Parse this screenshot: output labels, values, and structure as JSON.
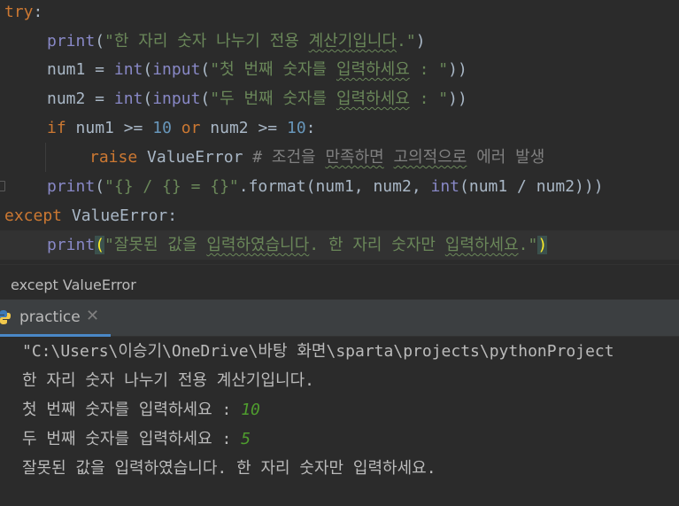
{
  "editor": {
    "l1": {
      "kw": "try",
      "colon": ":"
    },
    "l2": {
      "fn": "print",
      "open": "(",
      "str": "\"한 자리 숫자 나누기 전용 ",
      "str_typo": "계산기입니다",
      "str_end": ".\"",
      "close": ")"
    },
    "l3": {
      "var": "num1 = ",
      "fn1": "int",
      "p1": "(",
      "fn2": "input",
      "p2": "(",
      "str": "\"첫 번째 숫자를 ",
      "str_typo": "입력하세요",
      "str_end": " : \"",
      "close": "))"
    },
    "l4": {
      "var": "num2 = ",
      "fn1": "int",
      "p1": "(",
      "fn2": "input",
      "p2": "(",
      "str": "\"두 번째 숫자를 ",
      "str_typo": "입력하세요",
      "str_end": " : \"",
      "close": "))"
    },
    "l5": {
      "kw_if": "if",
      "a": " num1 >= ",
      "n1": "10",
      "kw_or": " or",
      "b": " num2 >= ",
      "n2": "10",
      "colon": ":"
    },
    "l6": {
      "kw": "raise",
      "sp": " ",
      "cls": "ValueError",
      "sp2": " ",
      "cmt1": "# 조건을 ",
      "cmt_t1": "만족하면",
      "cmt2": " ",
      "cmt_t2": "고의적으로",
      "cmt3": " 에러 발생"
    },
    "l7": {
      "fn": "print",
      "open": "(",
      "str": "\"{} / {} = {}\"",
      "rest1": ".format(num1, num2, ",
      "fn2": "int",
      "rest2": "(num1 / num2)))"
    },
    "l8": {
      "kw": "except",
      "sp": " ",
      "cls": "ValueError",
      "colon": ":"
    },
    "l9": {
      "fn": "print",
      "open": "(",
      "str_q": "\"",
      "str1": "잘못된 값을 ",
      "str_t1": "입력하였습니다",
      "str2": ". 한 자리 숫자만 ",
      "str_t2": "입력하세요",
      "str3": ".\"",
      "close": ")"
    }
  },
  "breadcrumb": "except ValueError",
  "run_tab": {
    "label": "practice",
    "close": "✕",
    "icon": "python-icon"
  },
  "console": {
    "path": "\"C:\\Users\\이승기\\OneDrive\\바탕 화면\\sparta\\projects\\pythonProject",
    "out1": "한 자리 숫자 나누기 전용 계산기입니다.",
    "prompt1": "첫 번째 숫자를 입력하세요 : ",
    "input1": "10",
    "prompt2": "두 번째 숫자를 입력하세요 : ",
    "input2": "5",
    "out2": "잘못된 값을 입력하였습니다. 한 자리 숫자만 입력하세요."
  },
  "colors": {
    "background": "#2b2b2b",
    "keyword": "#cc7832",
    "string": "#6a8759",
    "number": "#6897bb",
    "builtin": "#8888c6",
    "input": "#4f9d2e"
  }
}
